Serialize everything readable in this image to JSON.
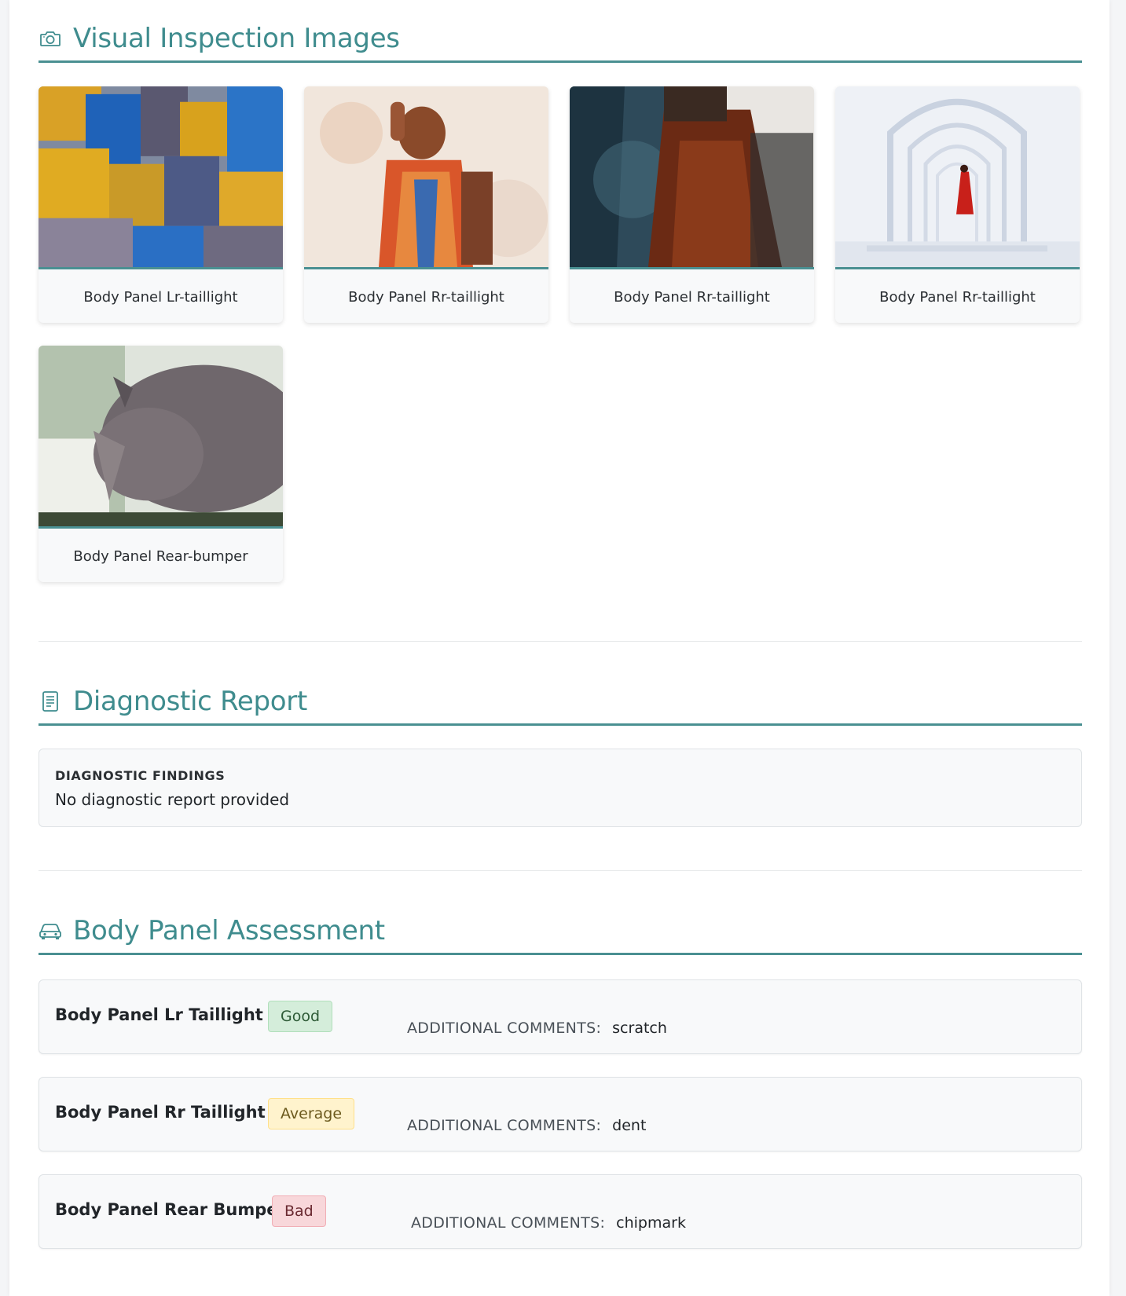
{
  "images_section": {
    "title": "Visual Inspection Images",
    "icon": "camera-icon",
    "images": [
      {
        "caption": "Body Panel Lr-taillight"
      },
      {
        "caption": "Body Panel Rr-taillight"
      },
      {
        "caption": "Body Panel Rr-taillight"
      },
      {
        "caption": "Body Panel Rr-taillight"
      },
      {
        "caption": "Body Panel Rear-bumper"
      }
    ]
  },
  "diagnostic_section": {
    "title": "Diagnostic Report",
    "icon": "document-icon",
    "label": "DIAGNOSTIC FINDINGS",
    "value": "No diagnostic report provided"
  },
  "assessment_section": {
    "title": "Body Panel Assessment",
    "icon": "car-icon",
    "comment_label": "ADDITIONAL COMMENTS:",
    "rows": [
      {
        "name": "Body Panel Lr Taillight",
        "status": "Good",
        "comment": "scratch"
      },
      {
        "name": "Body Panel Rr Taillight",
        "status": "Average",
        "comment": "dent"
      },
      {
        "name": "Body Panel Rear Bumper",
        "status": "Bad",
        "comment": "chipmark"
      }
    ]
  },
  "colors": {
    "accent": "#4a9092",
    "good": "#d4edda",
    "average": "#fff3cd",
    "bad": "#f8d7da"
  }
}
